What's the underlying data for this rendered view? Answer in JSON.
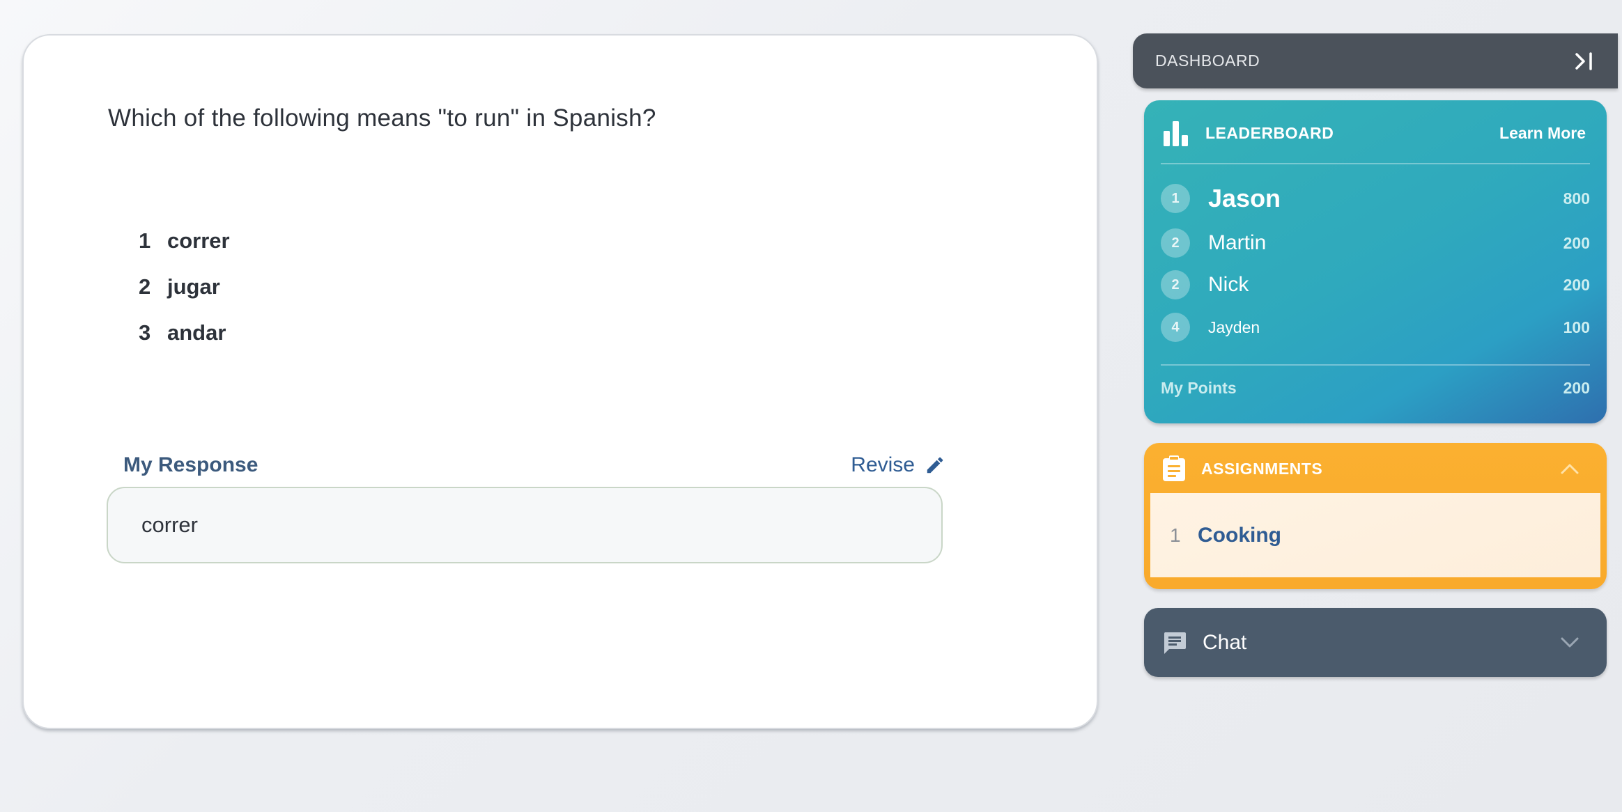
{
  "question": {
    "text": "Which of the following means \"to run\" in Spanish?",
    "options": [
      {
        "number": "1",
        "label": "correr"
      },
      {
        "number": "2",
        "label": "jugar"
      },
      {
        "number": "3",
        "label": "andar"
      }
    ]
  },
  "response": {
    "title": "My Response",
    "revise_label": "Revise",
    "value": "correr"
  },
  "dashboard": {
    "title": "DASHBOARD",
    "collapse_icon": "collapse-right-icon"
  },
  "leaderboard": {
    "title": "LEADERBOARD",
    "learn_more": "Learn More",
    "icon": "bar-chart-icon",
    "entries": [
      {
        "rank": "1",
        "name": "Jason",
        "points": "800"
      },
      {
        "rank": "2",
        "name": "Martin",
        "points": "200"
      },
      {
        "rank": "2",
        "name": "Nick",
        "points": "200"
      },
      {
        "rank": "4",
        "name": "Jayden",
        "points": "100"
      }
    ],
    "my_points_label": "My Points",
    "my_points_value": "200"
  },
  "assignments": {
    "title": "ASSIGNMENTS",
    "icon": "clipboard-icon",
    "items": [
      {
        "number": "1",
        "name": "Cooking"
      }
    ]
  },
  "chat": {
    "title": "Chat",
    "icon": "chat-icon"
  },
  "colors": {
    "accent_blue": "#2f5c93",
    "leaderboard_teal": "#2fa9bd",
    "assignments_orange": "#fbb030",
    "chat_slate": "#4b5b6c",
    "dashboard_dark": "#4b525b"
  }
}
